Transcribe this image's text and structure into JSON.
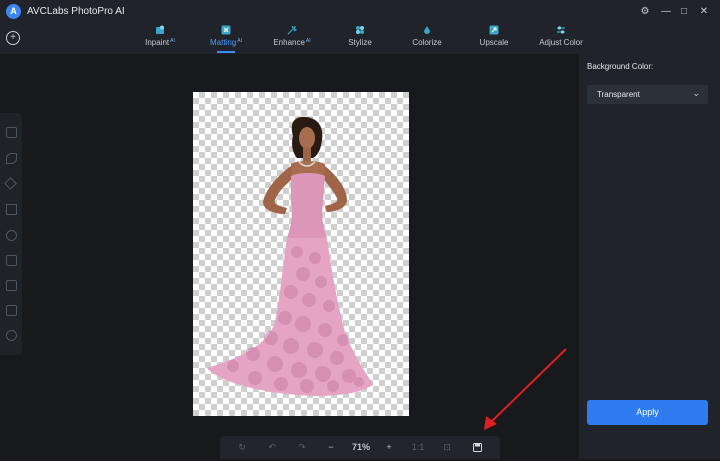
{
  "app": {
    "title": "AVCLabs PhotoPro AI",
    "logo_letter": "A"
  },
  "window": {
    "minimize": "—",
    "maximize": "□",
    "close": "✕",
    "settings": "⚙"
  },
  "tabs": [
    {
      "label": "Inpaint",
      "ai": "AI",
      "icon": "inpaint-icon"
    },
    {
      "label": "Matting",
      "ai": "AI",
      "icon": "matting-icon",
      "active": true
    },
    {
      "label": "Enhance",
      "ai": "AI",
      "icon": "enhance-icon"
    },
    {
      "label": "Stylize",
      "ai": "",
      "icon": "stylize-icon"
    },
    {
      "label": "Colorize",
      "ai": "",
      "icon": "colorize-icon"
    },
    {
      "label": "Upscale",
      "ai": "",
      "icon": "upscale-icon"
    },
    {
      "label": "Adjust Color",
      "ai": "",
      "icon": "adjust-color-icon"
    }
  ],
  "right_panel": {
    "bg_label": "Background Color:",
    "bg_value": "Transparent",
    "apply_label": "Apply"
  },
  "bottom_bar": {
    "zoom_minus": "−",
    "zoom": "71%",
    "zoom_plus": "+",
    "ratio": "1:1"
  },
  "colors": {
    "accent": "#3d8bff",
    "apply": "#2f7bf0",
    "arrow": "#e0201f",
    "dress": "#e8a9c8"
  }
}
